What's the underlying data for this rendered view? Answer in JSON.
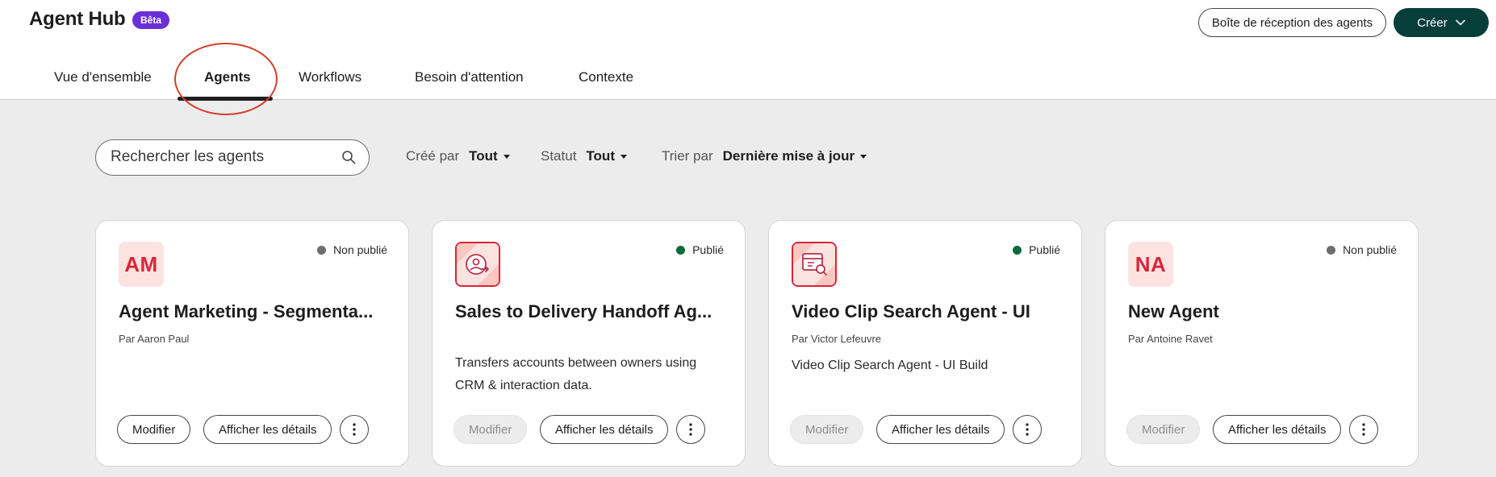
{
  "header": {
    "app_title": "Agent Hub",
    "beta_badge": "Bêta",
    "inbox_button": "Boîte de réception des agents",
    "create_button": "Créer"
  },
  "tabs": [
    {
      "label": "Vue d'ensemble",
      "active": false
    },
    {
      "label": "Agents",
      "active": true
    },
    {
      "label": "Workflows",
      "active": false
    },
    {
      "label": "Besoin d'attention",
      "active": false
    },
    {
      "label": "Contexte",
      "active": false
    }
  ],
  "search": {
    "placeholder": "Rechercher les agents"
  },
  "filters": {
    "created_by": {
      "label": "Créé par",
      "value": "Tout"
    },
    "status": {
      "label": "Statut",
      "value": "Tout"
    },
    "sort": {
      "label": "Trier par",
      "value": "Dernière mise à jour"
    }
  },
  "cards": [
    {
      "avatar_initials": "AM",
      "status": "Non publié",
      "title": "Agent Marketing - Segmenta...",
      "author": "Par Aaron Paul",
      "description": "",
      "edit_label": "Modifier",
      "details_label": "Afficher les détails"
    },
    {
      "avatar_icon": "handoff-user-icon",
      "status": "Publié",
      "title": "Sales to Delivery Handoff Ag...",
      "author": "",
      "description": "Transfers accounts between owners using CRM & interaction data.",
      "edit_label": "Modifier",
      "details_label": "Afficher les détails"
    },
    {
      "avatar_icon": "video-search-icon",
      "status": "Publié",
      "title": "Video Clip Search Agent - UI",
      "author": "Par Victor Lefeuvre",
      "description": "Video Clip Search Agent - UI Build",
      "edit_label": "Modifier",
      "details_label": "Afficher les détails"
    },
    {
      "avatar_initials": "NA",
      "status": "Non publié",
      "title": "New Agent",
      "author": "Par Antoine Ravet",
      "description": "",
      "edit_label": "Modifier",
      "details_label": "Afficher les détails"
    }
  ],
  "colors": {
    "accent_dark": "#063e3a",
    "beta_purple": "#6b2fd6",
    "published_green": "#0b6b3a",
    "unpublished_gray": "#6e6e6e",
    "avatar_red": "#d72638",
    "annotation_red": "#d2402b"
  }
}
